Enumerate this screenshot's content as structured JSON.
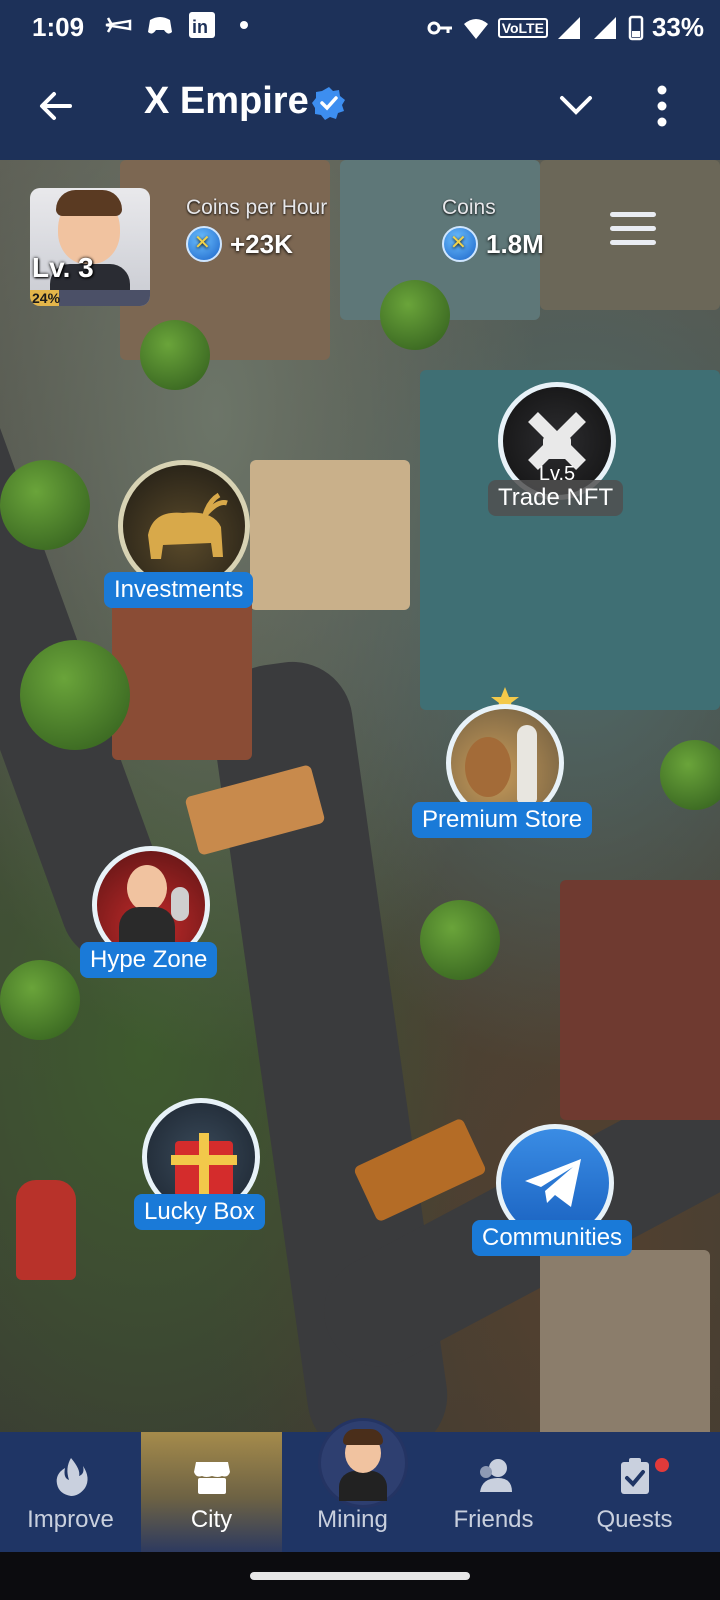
{
  "status_bar": {
    "time": "1:09",
    "battery": "33%",
    "network": "VoLTE"
  },
  "app_bar": {
    "title": "X Empire",
    "icons": [
      "back-arrow-icon",
      "verified-badge-icon",
      "chevron-down-icon",
      "more-vert-icon"
    ]
  },
  "profile": {
    "level": "Lv. 3",
    "progress_label": "24%",
    "progress": 0.24
  },
  "stats": {
    "coins_per_hour_label": "Coins per Hour",
    "coins_per_hour_value": "+23K",
    "coins_label": "Coins",
    "coins_value": "1.8M"
  },
  "map_spots": {
    "trade_nft": {
      "level": "Lv.5",
      "label": "Trade NFT"
    },
    "investments": {
      "label": "Investments"
    },
    "premium_store": {
      "label": "Premium Store"
    },
    "hype_zone": {
      "label": "Hype Zone"
    },
    "lucky_box": {
      "label": "Lucky Box"
    },
    "communities": {
      "label": "Communities"
    }
  },
  "bottom_nav": {
    "items": [
      {
        "label": "Improve",
        "icon": "flame-icon"
      },
      {
        "label": "City",
        "icon": "store-icon",
        "active": true
      },
      {
        "label": "Mining",
        "icon": "avatar"
      },
      {
        "label": "Friends",
        "icon": "friends-icon"
      },
      {
        "label": "Quests",
        "icon": "clipboard-check-icon",
        "badge": true
      }
    ]
  },
  "colors": {
    "app_bar_bg": "#1d3159",
    "tag_blue": "#1a7ad8",
    "nav_bg": "#1f3565",
    "active_gold": "#a58b4b",
    "badge_red": "#e23a3a"
  }
}
